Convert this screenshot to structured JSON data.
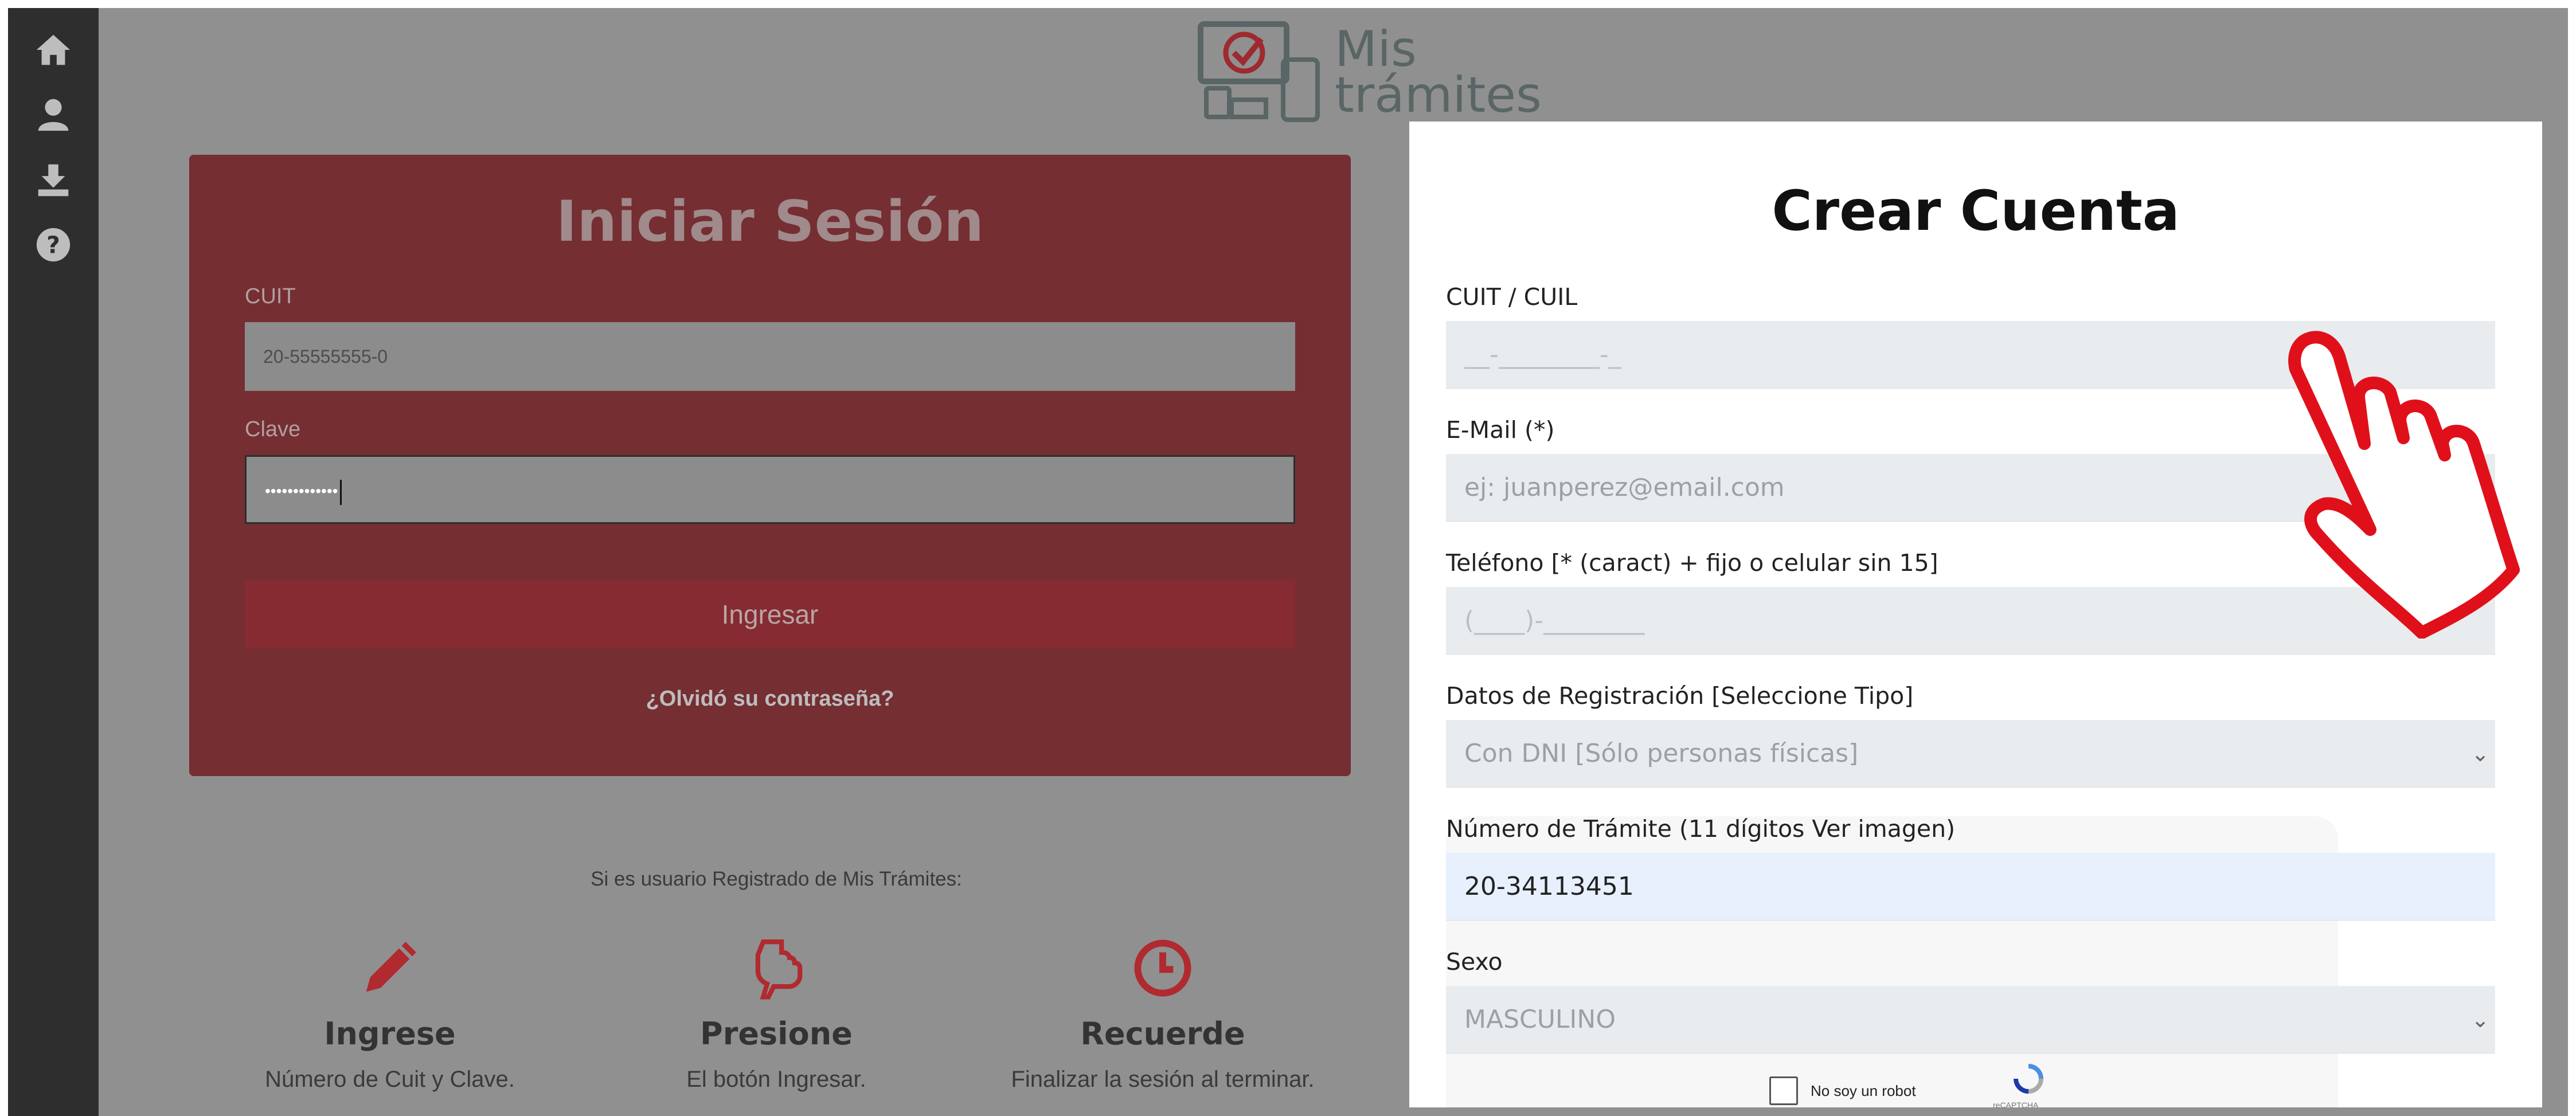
{
  "logo": {
    "line1": "Mis",
    "line2": "trámites"
  },
  "sidebar": {
    "icons": [
      "home-icon",
      "user-icon",
      "download-icon",
      "help-icon"
    ]
  },
  "login": {
    "title": "Iniciar Sesión",
    "cuit_label": "CUIT",
    "cuit_value": "20-55555555-0",
    "clave_label": "Clave",
    "clave_value": "•••••••••••••",
    "submit_label": "Ingresar",
    "forgot_label": "¿Olvidó su contraseña?"
  },
  "steps": {
    "intro": "Si es usuario Registrado de Mis Trámites:",
    "items": [
      {
        "icon": "pencil-icon",
        "title": "Ingrese",
        "desc": "Número de Cuit y Clave."
      },
      {
        "icon": "pointing-hand-icon",
        "title": "Presione",
        "desc": "El botón Ingresar."
      },
      {
        "icon": "clock-icon",
        "title": "Recuerde",
        "desc": "Finalizar la sesión al terminar."
      }
    ]
  },
  "create": {
    "title": "Crear Cuenta",
    "cuit_label": "CUIT / CUIL",
    "cuit_placeholder": "__-________-_",
    "email_label": "E-Mail (*)",
    "email_placeholder": "ej: juanperez@email.com",
    "phone_label": "Teléfono [* (caract) + fijo o celular sin 15]",
    "phone_placeholder": "(____)-________",
    "datos_label": "Datos de Registración [Seleccione Tipo]",
    "datos_value": "Con DNI [Sólo personas físicas]",
    "tramite_label": "Número de Trámite (11 dígitos Ver imagen)",
    "tramite_value": "20-34113451",
    "sexo_label": "Sexo",
    "sexo_value": "MASCULINO",
    "captcha_label": "No soy un robot",
    "captcha_brand": "reCAPTCHA"
  },
  "colors": {
    "accent": "#c0392b",
    "login_bg": "#752e32",
    "overlay": "#909090",
    "hand": "#e0101b"
  }
}
